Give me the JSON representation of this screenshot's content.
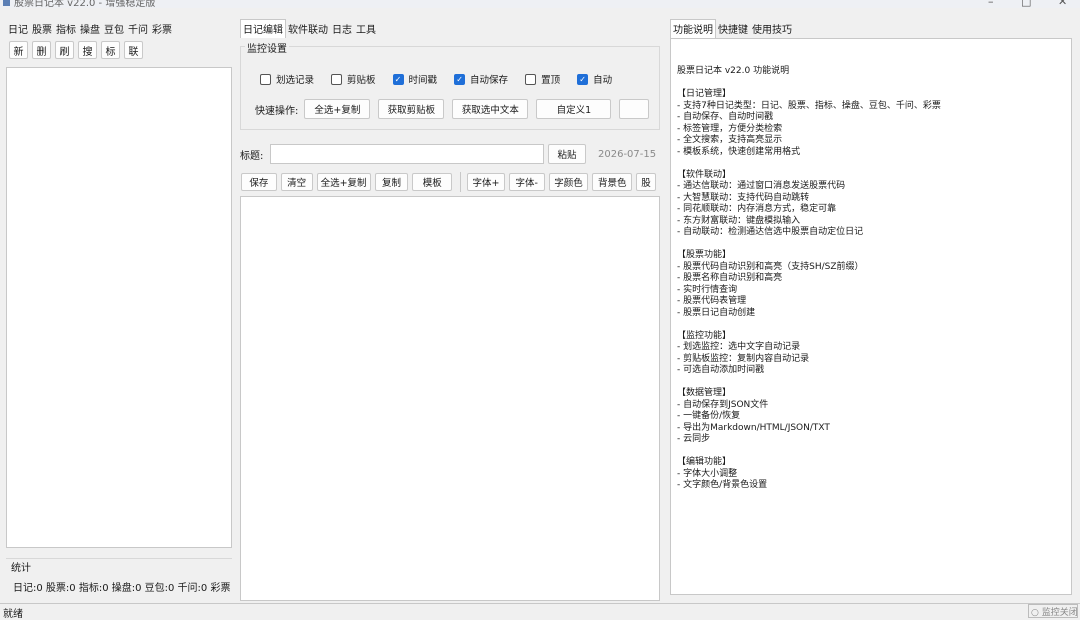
{
  "window": {
    "title": "股票日记本 v22.0 - 增强稳定版",
    "minimize": "–",
    "maximize": "□",
    "close": "✕"
  },
  "left": {
    "tabs": [
      "日记",
      "股票",
      "指标",
      "操盘",
      "豆包",
      "千问",
      "彩票"
    ],
    "buttons": [
      "新",
      "删",
      "刷",
      "搜",
      "标",
      "联"
    ],
    "stats_title": "统计",
    "stats_text": "日记:0 股票:0 指标:0 操盘:0 豆包:0 千问:0 彩票"
  },
  "center": {
    "tabs": [
      "日记编辑",
      "软件联动",
      "日志",
      "工具"
    ],
    "monitor_title": "监控设置",
    "checkboxes": [
      {
        "label": "划选记录",
        "checked": false
      },
      {
        "label": "剪贴板",
        "checked": false
      },
      {
        "label": "时间戳",
        "checked": true
      },
      {
        "label": "自动保存",
        "checked": true
      },
      {
        "label": "置顶",
        "checked": false
      },
      {
        "label": "自动",
        "checked": true
      }
    ],
    "quick_label": "快速操作:",
    "quick_buttons": [
      "全选+复制",
      "获取剪贴板",
      "获取选中文本",
      "自定义1"
    ],
    "title_label": "标题:",
    "title_value": "",
    "paste_button": "粘贴",
    "date": "2026-07-15",
    "editor_buttons_a": [
      "保存",
      "清空",
      "全选+复制",
      "复制",
      "模板"
    ],
    "editor_buttons_b": [
      "字体+",
      "字体-",
      "字颜色",
      "背景色",
      "股"
    ]
  },
  "right": {
    "tabs": [
      "功能说明",
      "快捷键",
      "使用技巧"
    ],
    "help_text": "股票日记本 v22.0 功能说明\n\n【日记管理】\n- 支持7种日记类型：日记、股票、指标、操盘、豆包、千问、彩票\n- 自动保存、自动时间戳\n- 标签管理，方便分类检索\n- 全文搜索，支持高亮显示\n- 模板系统，快速创建常用格式\n\n【软件联动】\n- 通达信联动：通过窗口消息发送股票代码\n- 大智慧联动：支持代码自动跳转\n- 同花顺联动：内存消息方式，稳定可靠\n- 东方财富联动：键盘模拟输入\n- 自动联动：检测通达信选中股票自动定位日记\n\n【股票功能】\n- 股票代码自动识别和高亮（支持SH/SZ前缀）\n- 股票名称自动识别和高亮\n- 实时行情查询\n- 股票代码表管理\n- 股票日记自动创建\n\n【监控功能】\n- 划选监控：选中文字自动记录\n- 剪贴板监控：复制内容自动记录\n- 可选自动添加时间戳\n\n【数据管理】\n- 自动保存到JSON文件\n- 一键备份/恢复\n- 导出为Markdown/HTML/JSON/TXT\n- 云同步\n\n【编辑功能】\n- 字体大小调整\n- 文字颜色/背景色设置"
  },
  "status": {
    "text": "就绪",
    "monitor": "○ 监控关闭"
  },
  "colors": {
    "checkbox_on": "#1f6fd8",
    "window_bg": "#f0f0f0"
  }
}
